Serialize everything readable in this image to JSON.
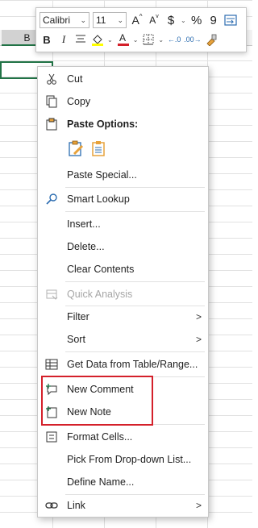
{
  "sheet": {
    "column_label": "B"
  },
  "mini_toolbar": {
    "font_name": "Calibri",
    "font_size": "11",
    "buttons": {
      "increase_font": "A",
      "decrease_font": "A",
      "currency": "$",
      "percent": "%",
      "comma": "9",
      "bold": "B",
      "italic": "I"
    },
    "fill_color": "#ffff00",
    "font_color": "#d4202a"
  },
  "context_menu": {
    "cut": "Cut",
    "copy": "Copy",
    "paste_options": "Paste Options:",
    "paste_special": "Paste Special...",
    "smart_lookup": "Smart Lookup",
    "insert": "Insert...",
    "delete": "Delete...",
    "clear_contents": "Clear Contents",
    "quick_analysis": "Quick Analysis",
    "filter": "Filter",
    "sort": "Sort",
    "get_data": "Get Data from Table/Range...",
    "new_comment": "New Comment",
    "new_note": "New Note",
    "format_cells": "Format Cells...",
    "pick_from_list": "Pick From Drop-down List...",
    "define_name": "Define Name...",
    "link": "Link"
  },
  "colors": {
    "highlight_border": "#d4202a",
    "excel_green": "#217346",
    "icon_blue": "#2b6cb0"
  }
}
